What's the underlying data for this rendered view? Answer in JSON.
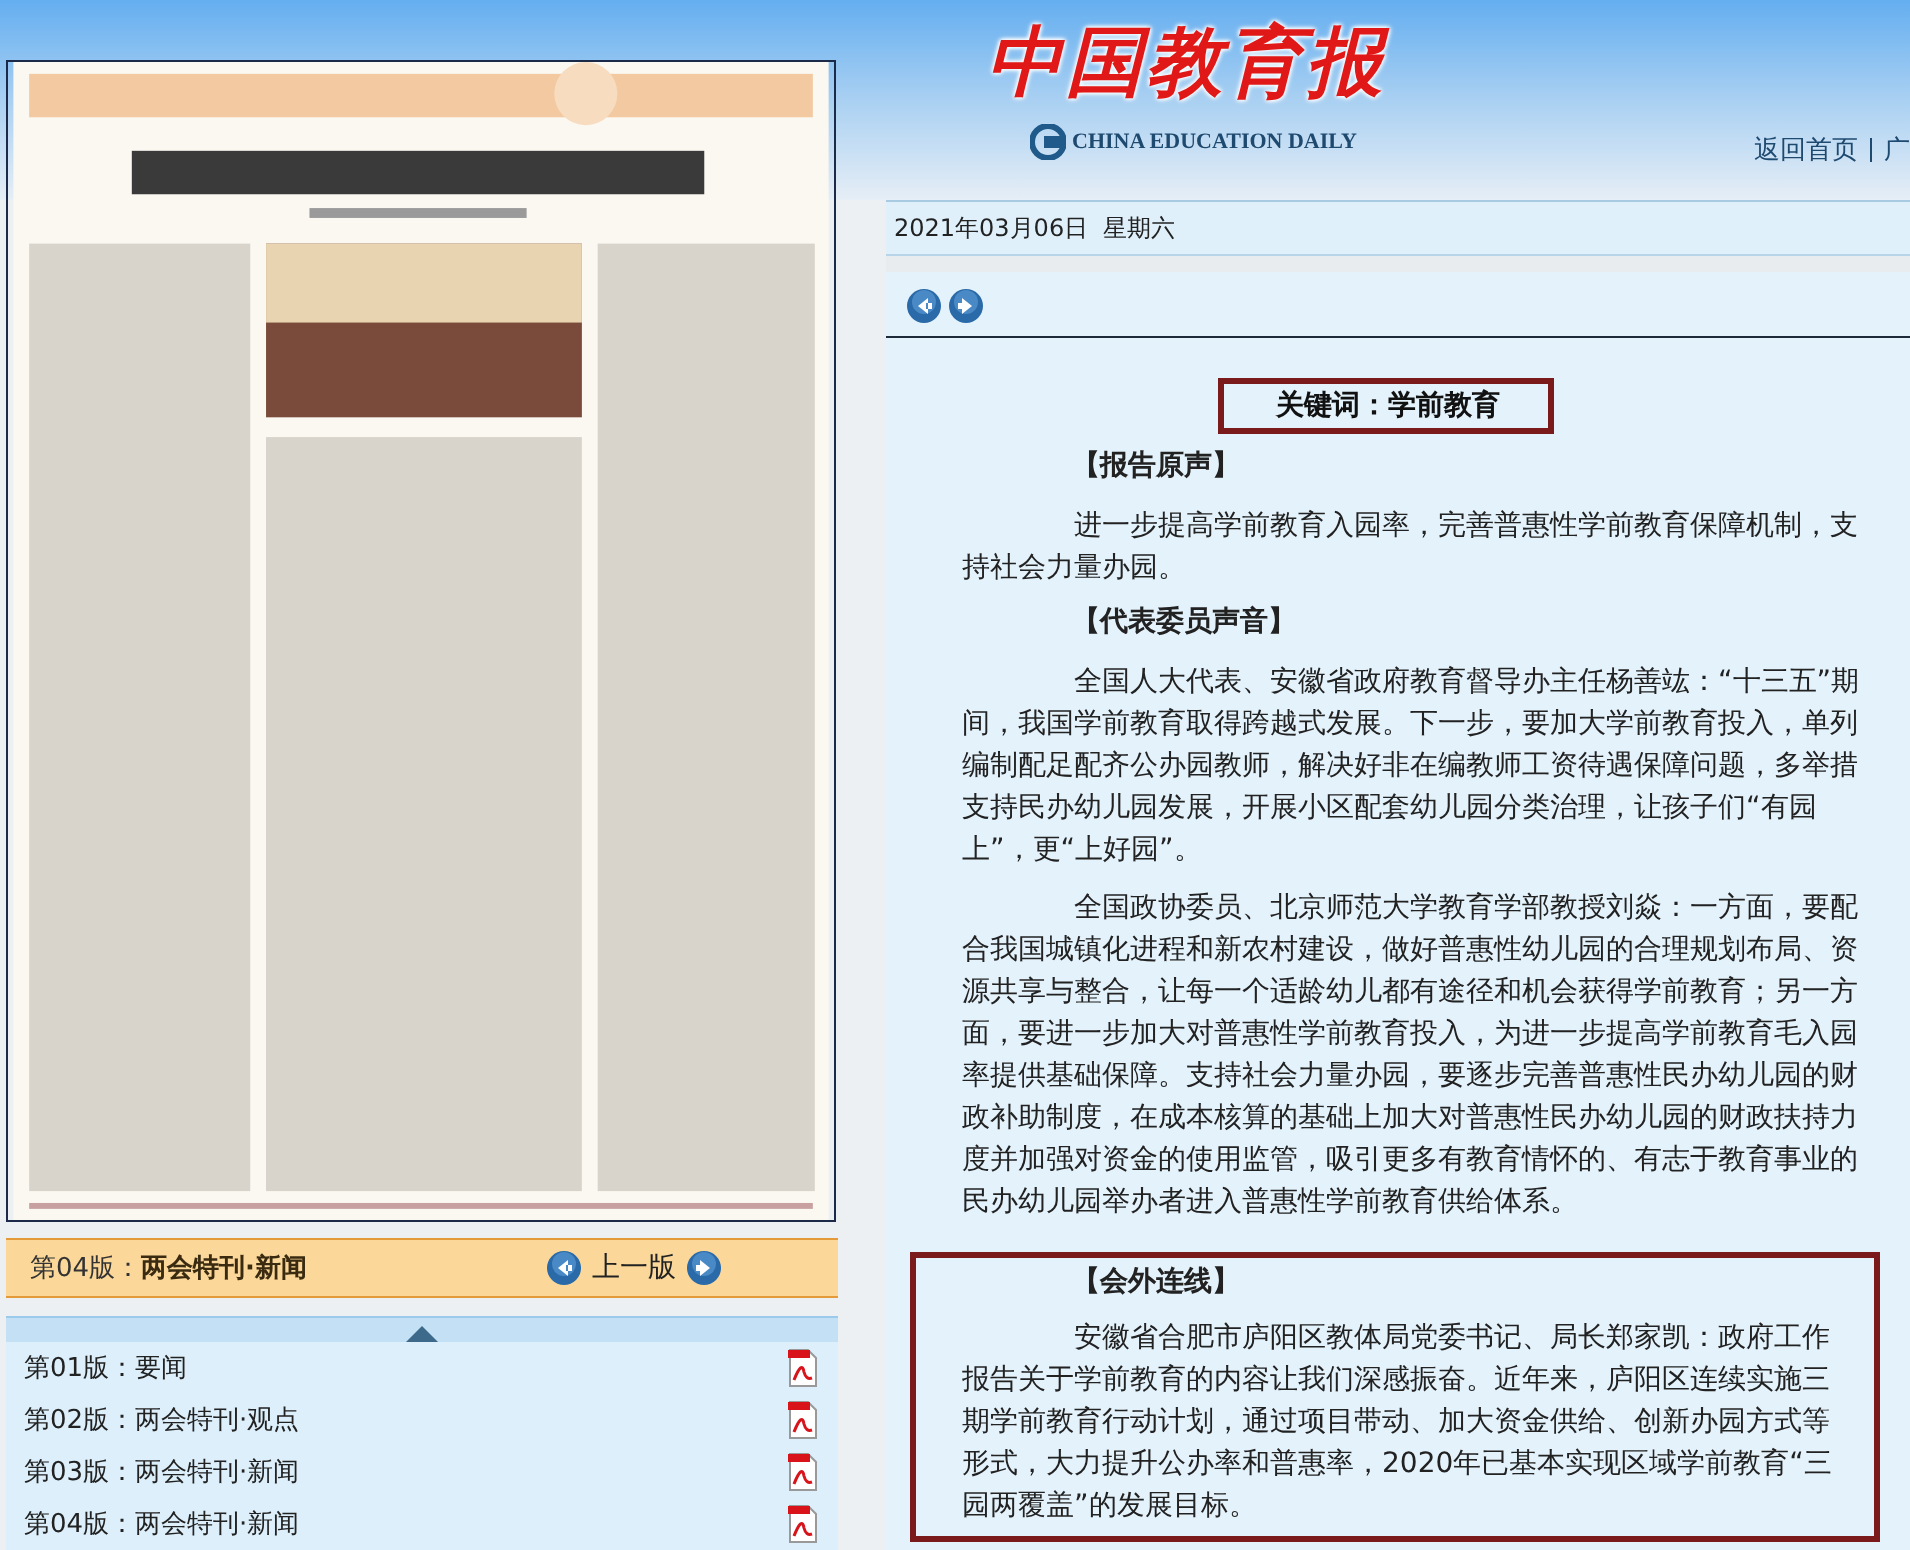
{
  "header": {
    "logo": "中国教育报",
    "logo_subtitle": "CHINA EDUCATION DAILY",
    "nav_links": [
      "返回首页",
      "广"
    ]
  },
  "date": "2021年03月06日  星期六",
  "page_bar": {
    "title": "第04版：**两会特刊·新闻**",
    "prev_label": "上一版"
  },
  "page_list": [
    {
      "label": "第01版：要闻"
    },
    {
      "label": "第02版：两会特刊·观点"
    },
    {
      "label": "第03版：两会特刊·新闻"
    },
    {
      "label": "第04版：两会特刊·新闻"
    }
  ],
  "article": {
    "keyword": "关键词：学前教育",
    "sections": [
      {
        "heading": "【报告原声】",
        "boxed": false,
        "paragraphs": [
          "进一步提高学前教育入园率，完善普惠性学前教育保障机制，支持社会力量办园。"
        ]
      },
      {
        "heading": "【代表委员声音】",
        "boxed": false,
        "paragraphs": [
          "全国人大代表、安徽省政府教育督导办主任杨善竑：“十三五”期间，我国学前教育取得跨越式发展。下一步，要加大学前教育投入，单列编制配足配齐公办园教师，解决好非在编教师工资待遇保障问题，多举措支持民办幼儿园发展，开展小区配套幼儿园分类治理，让孩子们“有园上”，更“上好园”。",
          "全国政协委员、北京师范大学教育学部教授刘焱：一方面，要配合我国城镇化进程和新农村建设，做好普惠性幼儿园的合理规划布局、资源共享与整合，让每一个适龄幼儿都有途径和机会获得学前教育；另一方面，要进一步加大对普惠性学前教育投入，为进一步提高学前教育毛入园率提供基础保障。支持社会力量办园，要逐步完善普惠性民办幼儿园的财政补助制度，在成本核算的基础上加大对普惠性民办幼儿园的财政扶持力度并加强对资金的使用监管，吸引更多有教育情怀的、有志于教育事业的民办幼儿园举办者进入普惠性学前教育供给体系。"
        ]
      },
      {
        "heading": "【会外连线】",
        "boxed": true,
        "paragraphs": [
          "安徽省合肥市庐阳区教体局党委书记、局长郑家凯：政府工作报告关于学前教育的内容让我们深感振奋。近年来，庐阳区连续实施三期学前教育行动计划，通过项目带动、加大资金供给、创新办园方式等形式，大力提升公办率和普惠率，2020年已基本实现区域学前教育“三园两覆盖”的发展目标。"
        ]
      }
    ]
  }
}
